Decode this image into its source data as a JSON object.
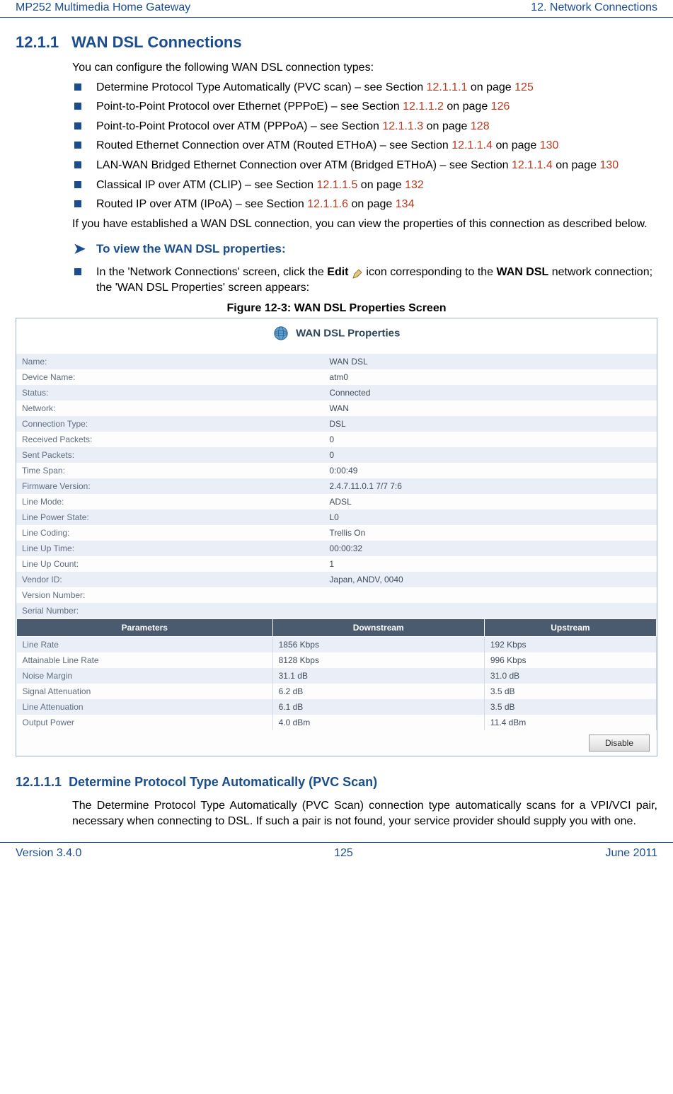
{
  "header": {
    "left": "MP252 Multimedia Home Gateway",
    "right": "12. Network Connections"
  },
  "footer": {
    "version": "Version 3.4.0",
    "page": "125",
    "date": "June 2011"
  },
  "section": {
    "num": "12.1.1",
    "title": "WAN DSL Connections",
    "intro": "You can configure the following WAN DSL connection types:",
    "bullets": [
      {
        "pre": "Determine Protocol Type Automatically (PVC scan) – see Section ",
        "ref1": "12.1.1.1",
        "mid": " on page ",
        "ref2": "125"
      },
      {
        "pre": "Point-to-Point Protocol over Ethernet (PPPoE) – see Section ",
        "ref1": "12.1.1.2",
        "mid": " on page ",
        "ref2": "126"
      },
      {
        "pre": "Point-to-Point Protocol over ATM (PPPoA) – see Section ",
        "ref1": "12.1.1.3",
        "mid": " on page ",
        "ref2": "128"
      },
      {
        "pre": "Routed Ethernet Connection over ATM (Routed ETHoA) – see Section ",
        "ref1": "12.1.1.4",
        "mid": " on page ",
        "ref2": "130"
      },
      {
        "pre": "LAN-WAN Bridged Ethernet Connection over ATM (Bridged ETHoA) – see Section ",
        "ref1": "12.1.1.4",
        "mid": " on page ",
        "ref2": "130"
      },
      {
        "pre": "Classical IP over ATM (CLIP) – see Section ",
        "ref1": "12.1.1.5",
        "mid": " on page ",
        "ref2": "132"
      },
      {
        "pre": "Routed IP over ATM (IPoA) – see Section ",
        "ref1": "12.1.1.6",
        "mid": " on page ",
        "ref2": "134"
      }
    ],
    "para_after_bullets": "If you have established a WAN DSL connection, you can view the properties of this connection as described below.",
    "proc_head": "To view the WAN DSL properties:",
    "proc_step_pre": "In the 'Network Connections' screen, click the ",
    "proc_step_edit": "Edit",
    "proc_step_mid1": " icon corresponding to the ",
    "proc_step_wan": "WAN DSL",
    "proc_step_post": " network connection; the 'WAN DSL Properties' screen appears:"
  },
  "figure_caption": "Figure 12-3: WAN DSL Properties Screen",
  "panel": {
    "title": "WAN DSL Properties",
    "rows": [
      {
        "k": "Name:",
        "v": "WAN DSL"
      },
      {
        "k": "Device Name:",
        "v": "atm0"
      },
      {
        "k": "Status:",
        "v": "Connected",
        "connected": true
      },
      {
        "k": "Network:",
        "v": "WAN"
      },
      {
        "k": "Connection Type:",
        "v": "DSL"
      },
      {
        "k": "Received Packets:",
        "v": "0"
      },
      {
        "k": "Sent Packets:",
        "v": "0"
      },
      {
        "k": "Time Span:",
        "v": "0:00:49"
      },
      {
        "k": "Firmware Version:",
        "v": "2.4.7.11.0.1 7/7 7:6"
      },
      {
        "k": "Line Mode:",
        "v": "ADSL"
      },
      {
        "k": "Line Power State:",
        "v": "L0"
      },
      {
        "k": "Line Coding:",
        "v": "Trellis On"
      },
      {
        "k": "Line Up Time:",
        "v": "00:00:32"
      },
      {
        "k": "Line Up Count:",
        "v": "1"
      },
      {
        "k": "Vendor ID:",
        "v": "Japan, ANDV, 0040"
      },
      {
        "k": "Version Number:",
        "v": ""
      },
      {
        "k": "Serial Number:",
        "v": ""
      }
    ],
    "params_headers": [
      "Parameters",
      "Downstream",
      "Upstream"
    ],
    "params": [
      {
        "label": "Line Rate",
        "down": "1856 Kbps",
        "up": "192 Kbps"
      },
      {
        "label": "Attainable Line Rate",
        "down": "8128 Kbps",
        "up": "996 Kbps"
      },
      {
        "label": "Noise Margin",
        "down": "31.1 dB",
        "up": "31.0 dB"
      },
      {
        "label": "Signal Attenuation",
        "down": "6.2 dB",
        "up": "3.5 dB"
      },
      {
        "label": "Line Attenuation",
        "down": "6.1 dB",
        "up": "3.5 dB"
      },
      {
        "label": "Output Power",
        "down": "4.0 dBm",
        "up": "11.4 dBm"
      }
    ],
    "disable_label": "Disable"
  },
  "subsection": {
    "num": "12.1.1.1",
    "title": "Determine Protocol Type Automatically (PVC Scan)",
    "body": "The Determine Protocol Type Automatically (PVC Scan) connection type automatically scans for a VPI/VCI pair, necessary when connecting to DSL. If such a pair is not found, your service provider should supply you with one."
  }
}
